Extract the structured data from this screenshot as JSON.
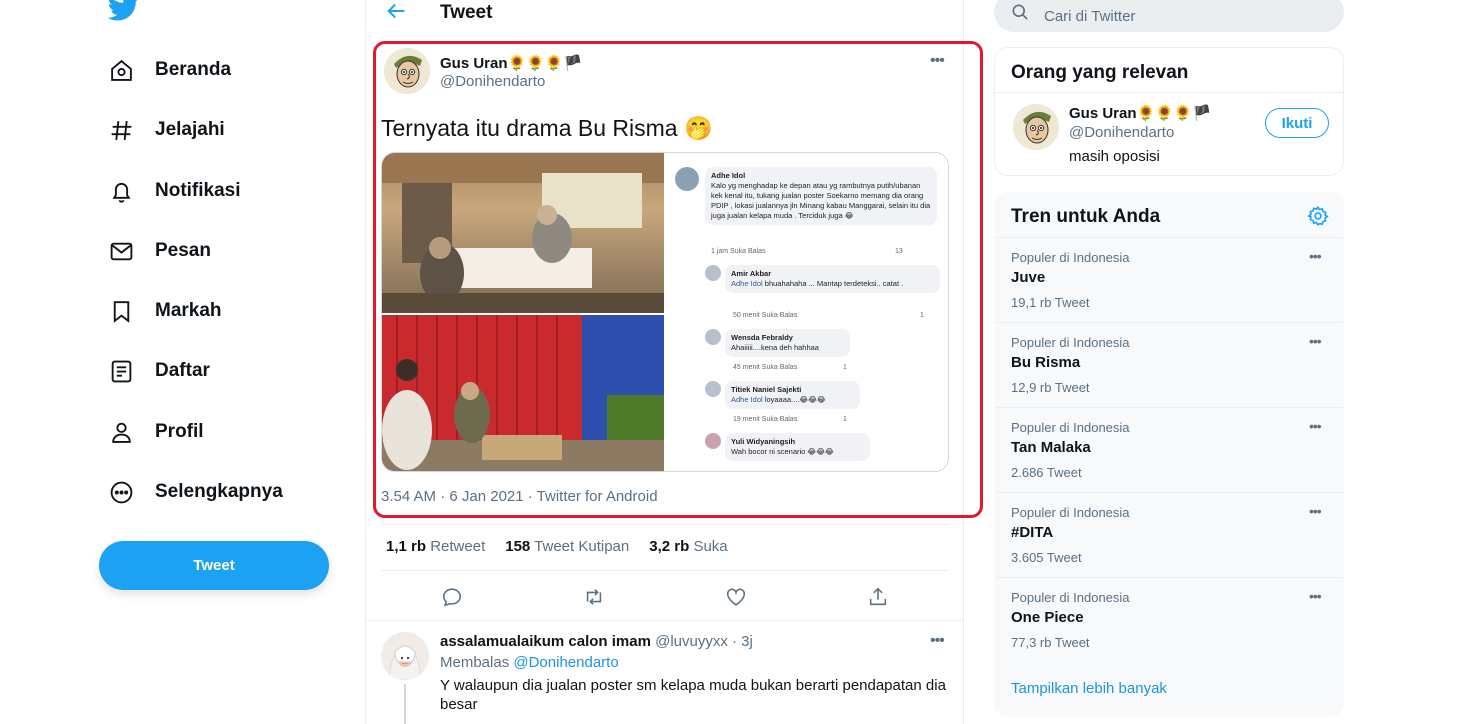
{
  "nav": {
    "items": [
      {
        "label": "Beranda",
        "icon": "home-icon"
      },
      {
        "label": "Jelajahi",
        "icon": "hashtag-icon"
      },
      {
        "label": "Notifikasi",
        "icon": "bell-icon"
      },
      {
        "label": "Pesan",
        "icon": "mail-icon"
      },
      {
        "label": "Markah",
        "icon": "bookmark-icon"
      },
      {
        "label": "Daftar",
        "icon": "list-icon"
      },
      {
        "label": "Profil",
        "icon": "person-icon"
      },
      {
        "label": "Selengkapnya",
        "icon": "more-circle-icon"
      }
    ],
    "tweet_button": "Tweet"
  },
  "header": {
    "title": "Tweet"
  },
  "tweet": {
    "name": "Gus Uran🌻🌻🌻🏴",
    "handle": "@Donihendarto",
    "text": "Ternyata itu drama Bu Risma 🤭",
    "meta": "3.54 AM · 6 Jan 2021 · Twitter for Android",
    "stats": {
      "retweets": "1,1 rb",
      "retweets_label": "Retweet",
      "quotes": "158",
      "quotes_label": "Tweet Kutipan",
      "likes": "3,2 rb",
      "likes_label": "Suka"
    },
    "media_comments": [
      {
        "name": "Adhe Idol",
        "text": "Kalo yg menghadap ke depan atau yg rambutnya putih/ubanan kek kenal itu, tukang jualan poster Soekarno  memang dia orang PDIP , lokasi jualannya jln Minang kabau Manggarai, selain itu dia juga jualan kelapa muda . Terciduk juga 😂",
        "meta": "1 jam    Suka    Balas",
        "count": "13"
      },
      {
        "name": "Amir Akbar",
        "mention": "Adhe Idol",
        "text": " bhuahahaha ... Mantap terdeteksi.. catat .",
        "meta": "50 menit    Suka    Balas",
        "count": "1"
      },
      {
        "name": "Wensda Febraldy",
        "text": "Ahaiiiii....kena deh hahhaa",
        "meta": "45 menit    Suka    Balas",
        "count": "1"
      },
      {
        "name": "Titiek Naniel Sajekti",
        "mention": "Adhe Idol",
        "text": " loyaaaa....😂😂😂",
        "meta": "19 menit    Suka    Balas",
        "count": "1"
      },
      {
        "name": "Yuli Widyaningsih",
        "text": "Wah bocor ni scenario 😂😂😂",
        "meta": "",
        "count": ""
      }
    ]
  },
  "reply": {
    "name": "assalamualaikum calon imam",
    "handle": "@luvuyyxx · 3j",
    "replying_label": "Membalas",
    "replying_to": "@Donihendarto",
    "text": "Y walaupun dia jualan poster sm kelapa muda bukan berarti pendapatan dia besar"
  },
  "search": {
    "placeholder": "Cari di Twitter"
  },
  "relevant": {
    "title": "Orang yang relevan",
    "name": "Gus Uran🌻🌻🌻🏴",
    "handle": "@Donihendarto",
    "bio": "masih oposisi",
    "follow_label": "Ikuti"
  },
  "trends": {
    "title": "Tren untuk Anda",
    "items": [
      {
        "context": "Populer di Indonesia",
        "name": "Juve",
        "count": "19,1 rb Tweet"
      },
      {
        "context": "Populer di Indonesia",
        "name": "Bu Risma",
        "count": "12,9 rb Tweet"
      },
      {
        "context": "Populer di Indonesia",
        "name": "Tan Malaka",
        "count": "2.686 Tweet"
      },
      {
        "context": "Populer di Indonesia",
        "name": "#DITA",
        "count": "3.605 Tweet"
      },
      {
        "context": "Populer di Indonesia",
        "name": "One Piece",
        "count": "77,3 rb Tweet"
      }
    ],
    "show_more": "Tampilkan lebih banyak"
  },
  "colors": {
    "accent": "#1da1f2",
    "highlight": "#e0192b",
    "text_secondary": "#5b7083"
  }
}
